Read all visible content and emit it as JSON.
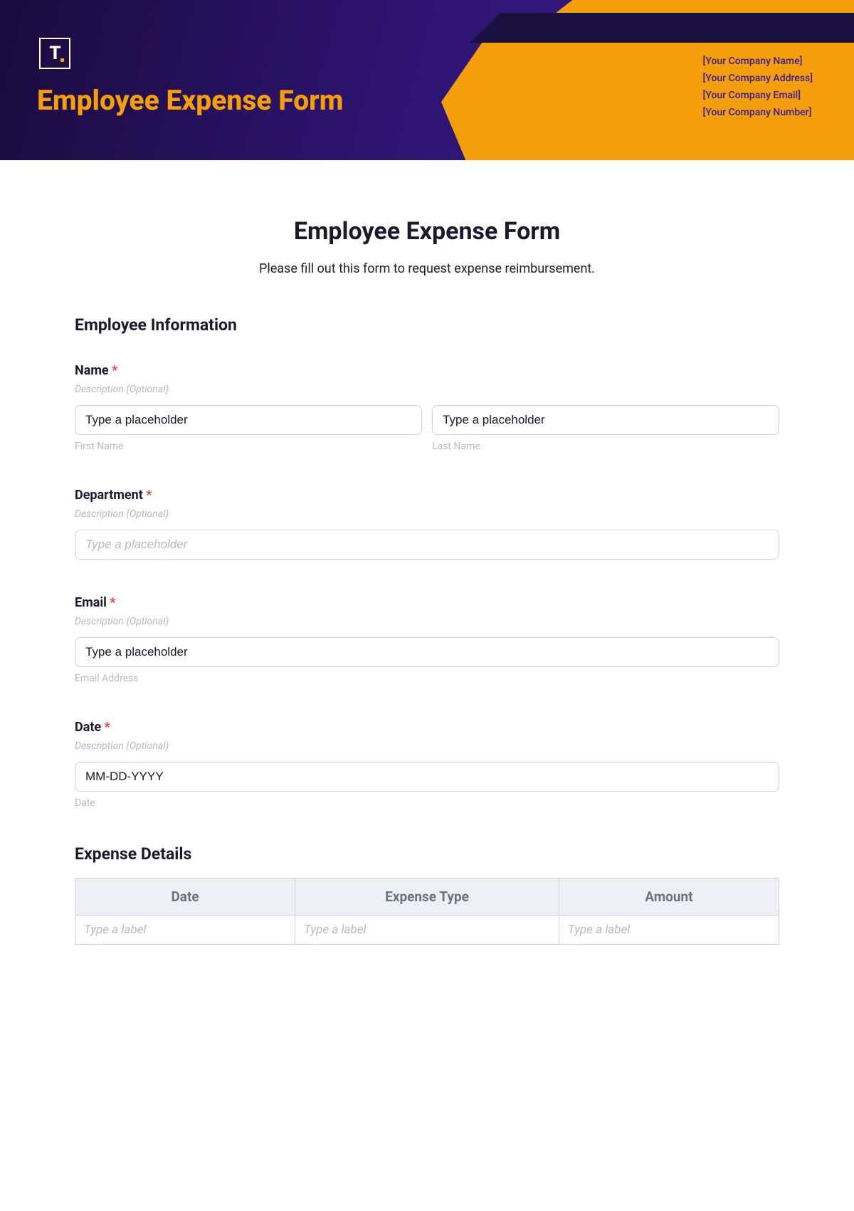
{
  "header": {
    "title": "Employee Expense Form",
    "logo_text": "T",
    "company": {
      "name": "[Your Company Name]",
      "address": "[Your Company Address]",
      "email": "[Your Company Email]",
      "number": "[Your Company Number]"
    }
  },
  "form": {
    "title": "Employee Expense Form",
    "subtitle": "Please fill out this form to request expense reimbursement.",
    "section_employee": "Employee Information",
    "name": {
      "label": "Name",
      "desc": "Description (Optional)",
      "first_value": "Type a placeholder",
      "first_sub": "First Name",
      "last_value": "Type a placeholder",
      "last_sub": "Last Name"
    },
    "department": {
      "label": "Department",
      "desc": "Description (Optional)",
      "placeholder": "Type a placeholder"
    },
    "email": {
      "label": "Email",
      "desc": "Description (Optional)",
      "value": "Type a placeholder",
      "sub": "Email Address"
    },
    "date": {
      "label": "Date",
      "desc": "Description (Optional)",
      "value": "MM-DD-YYYY",
      "sub": "Date"
    },
    "section_expense": "Expense Details",
    "table": {
      "headers": [
        "Date",
        "Expense Type",
        "Amount"
      ],
      "row_placeholder": "Type a label"
    }
  }
}
